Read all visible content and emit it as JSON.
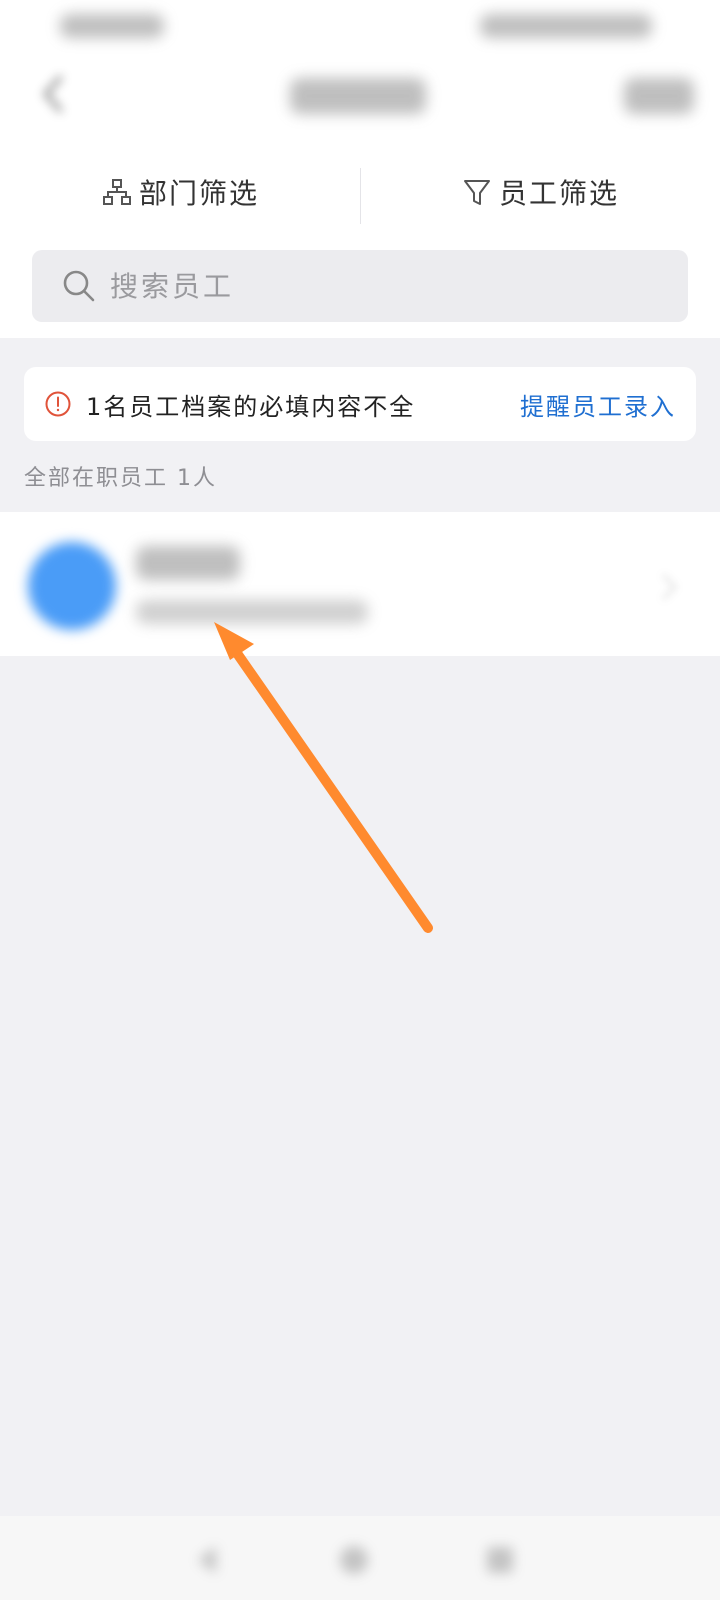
{
  "filters": {
    "department_label": "部门筛选",
    "employee_label": "员工筛选"
  },
  "search": {
    "placeholder": "搜索员工"
  },
  "alert": {
    "message": "1名员工档案的必填内容不全",
    "action_label": "提醒员工录入"
  },
  "list": {
    "section_title": "全部在职员工 1人"
  },
  "colors": {
    "accent": "#1f6fd1",
    "avatar": "#4a9cf7",
    "warning": "#e0533a",
    "annotation_arrow": "#ff8a2e"
  },
  "icons": {
    "department": "org-chart-icon",
    "employee_filter": "funnel-icon",
    "search": "search-icon",
    "alert": "exclamation-circle-icon"
  }
}
